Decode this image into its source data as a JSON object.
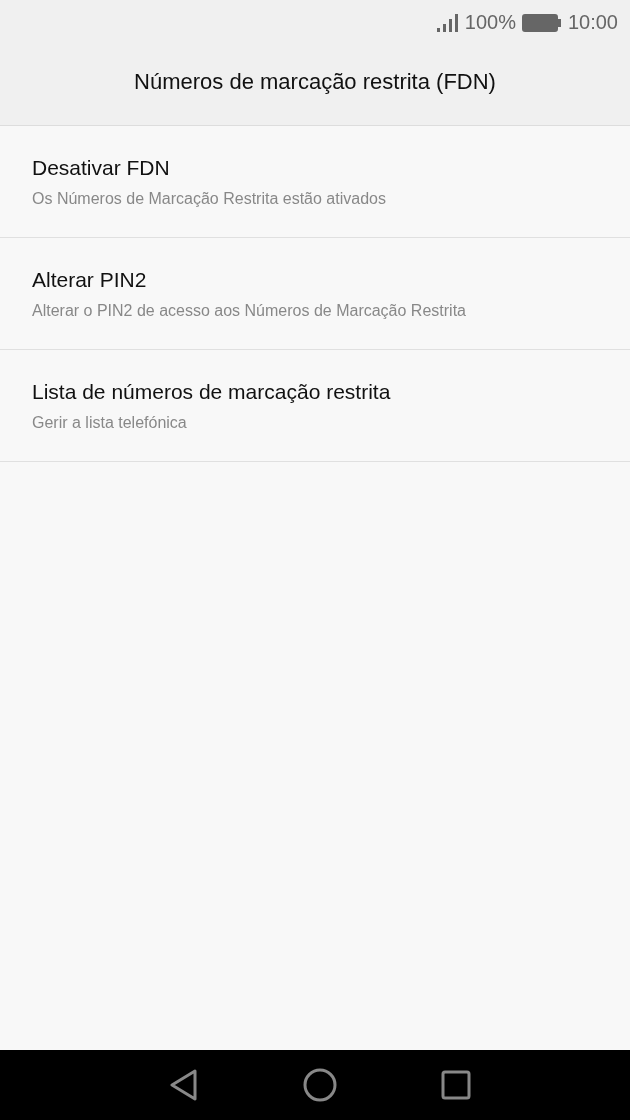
{
  "status_bar": {
    "battery": "100%",
    "time": "10:00"
  },
  "title": "Números de marcação restrita (FDN)",
  "items": [
    {
      "title": "Desativar FDN",
      "summary": "Os Números de Marcação Restrita estão ativados"
    },
    {
      "title": "Alterar PIN2",
      "summary": "Alterar o PIN2 de acesso aos Números de Marcação Restrita"
    },
    {
      "title": "Lista de números de marcação restrita",
      "summary": "Gerir a lista telefónica"
    }
  ]
}
